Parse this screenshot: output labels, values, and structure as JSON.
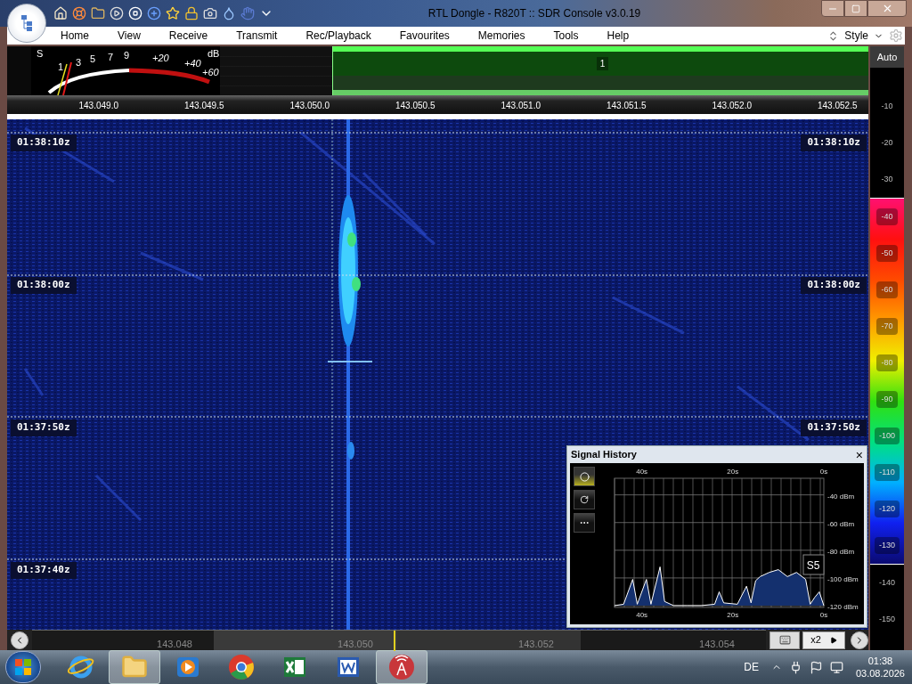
{
  "window": {
    "title": "RTL Dongle - R820T :: SDR Console v3.0.19"
  },
  "menu": [
    "Home",
    "View",
    "Receive",
    "Transmit",
    "Rec/Playback",
    "Favourites",
    "Memories",
    "Tools",
    "Help"
  ],
  "style_menu": "Style",
  "s_meter": {
    "labels": [
      "S",
      "1",
      "3",
      "5",
      "7",
      "9",
      "+20",
      "+40",
      "+60",
      "dB"
    ]
  },
  "spectrum": {
    "marker": "1"
  },
  "frequency_scale": [
    "143.049.0",
    "143.049.5",
    "143.050.0",
    "143.050.5",
    "143.051.0",
    "143.051.5",
    "143.052.0",
    "143.052.5"
  ],
  "waterfall": {
    "left_time_labels": [
      "01:38:10z",
      "01:38:00z",
      "01:37:50z",
      "01:37:40z"
    ],
    "right_time_labels": [
      "01:38:10z",
      "01:38:00z",
      "01:37:50z"
    ]
  },
  "level_scale": {
    "button": "Auto",
    "labels": [
      {
        "text": "-10",
        "highlighted": false
      },
      {
        "text": "-20",
        "highlighted": false
      },
      {
        "text": "-30",
        "highlighted": false
      },
      {
        "text": "-40",
        "highlighted": true
      },
      {
        "text": "-50",
        "highlighted": true
      },
      {
        "text": "-60",
        "highlighted": true
      },
      {
        "text": "-70",
        "highlighted": true
      },
      {
        "text": "-80",
        "highlighted": true
      },
      {
        "text": "-90",
        "highlighted": true
      },
      {
        "text": "-100",
        "highlighted": true
      },
      {
        "text": "-110",
        "highlighted": true
      },
      {
        "text": "-120",
        "highlighted": true
      },
      {
        "text": "-130",
        "highlighted": true
      },
      {
        "text": "-140",
        "highlighted": false
      },
      {
        "text": "-150",
        "highlighted": false
      }
    ]
  },
  "signal_history": {
    "title": "Signal History",
    "close": "×",
    "tools": [
      {
        "kind": "record",
        "selected": true
      },
      {
        "kind": "refresh",
        "selected": false
      },
      {
        "kind": "more",
        "selected": false
      }
    ],
    "tag": "S5",
    "chart_data": {
      "type": "line",
      "x": [
        46,
        44,
        42,
        41,
        39,
        38,
        36,
        35,
        33,
        30,
        27,
        24,
        23,
        22,
        19,
        17,
        16,
        15,
        14,
        12,
        10,
        8,
        6,
        4,
        3,
        2,
        1,
        0
      ],
      "grid": true,
      "series": [
        {
          "color": "#ffffff",
          "values": [
            -120,
            -119,
            -101,
            -119,
            -101,
            -119,
            -92,
            -117,
            -120,
            -120,
            -120,
            -119,
            -110,
            -118,
            -119,
            -106,
            -118,
            -102,
            -99,
            -96,
            -94,
            -99,
            -96,
            -101,
            -119,
            -114,
            -110,
            -120
          ]
        }
      ],
      "xlim": [
        46,
        0
      ],
      "ylim": [
        -120,
        -28
      ],
      "xticks": [
        {
          "value": 40,
          "label": "40s"
        },
        {
          "value": 20,
          "label": "20s"
        },
        {
          "value": 0,
          "label": "0s"
        }
      ],
      "yticks": [
        {
          "value": -40,
          "label": "-40 dBm"
        },
        {
          "value": -60,
          "label": "-60 dBm"
        },
        {
          "value": -80,
          "label": "-80 dBm"
        },
        {
          "value": -100,
          "label": "-100 dBm"
        },
        {
          "value": -120,
          "label": "-120 dBm"
        }
      ]
    }
  },
  "bottom_scale": [
    "143.048",
    "143.050",
    "143.052",
    "143.054"
  ],
  "zoom_button": "x2",
  "taskbar": {
    "apps": [
      {
        "kind": "browser",
        "selected": false
      },
      {
        "kind": "folder",
        "selected": true
      },
      {
        "kind": "media",
        "selected": false
      },
      {
        "kind": "chrome",
        "selected": false
      },
      {
        "kind": "spreadsheet",
        "selected": false
      },
      {
        "kind": "document",
        "selected": false
      },
      {
        "kind": "radio",
        "selected": true
      }
    ],
    "language": "DE",
    "time": "01:38",
    "date": "03.08.2026"
  }
}
